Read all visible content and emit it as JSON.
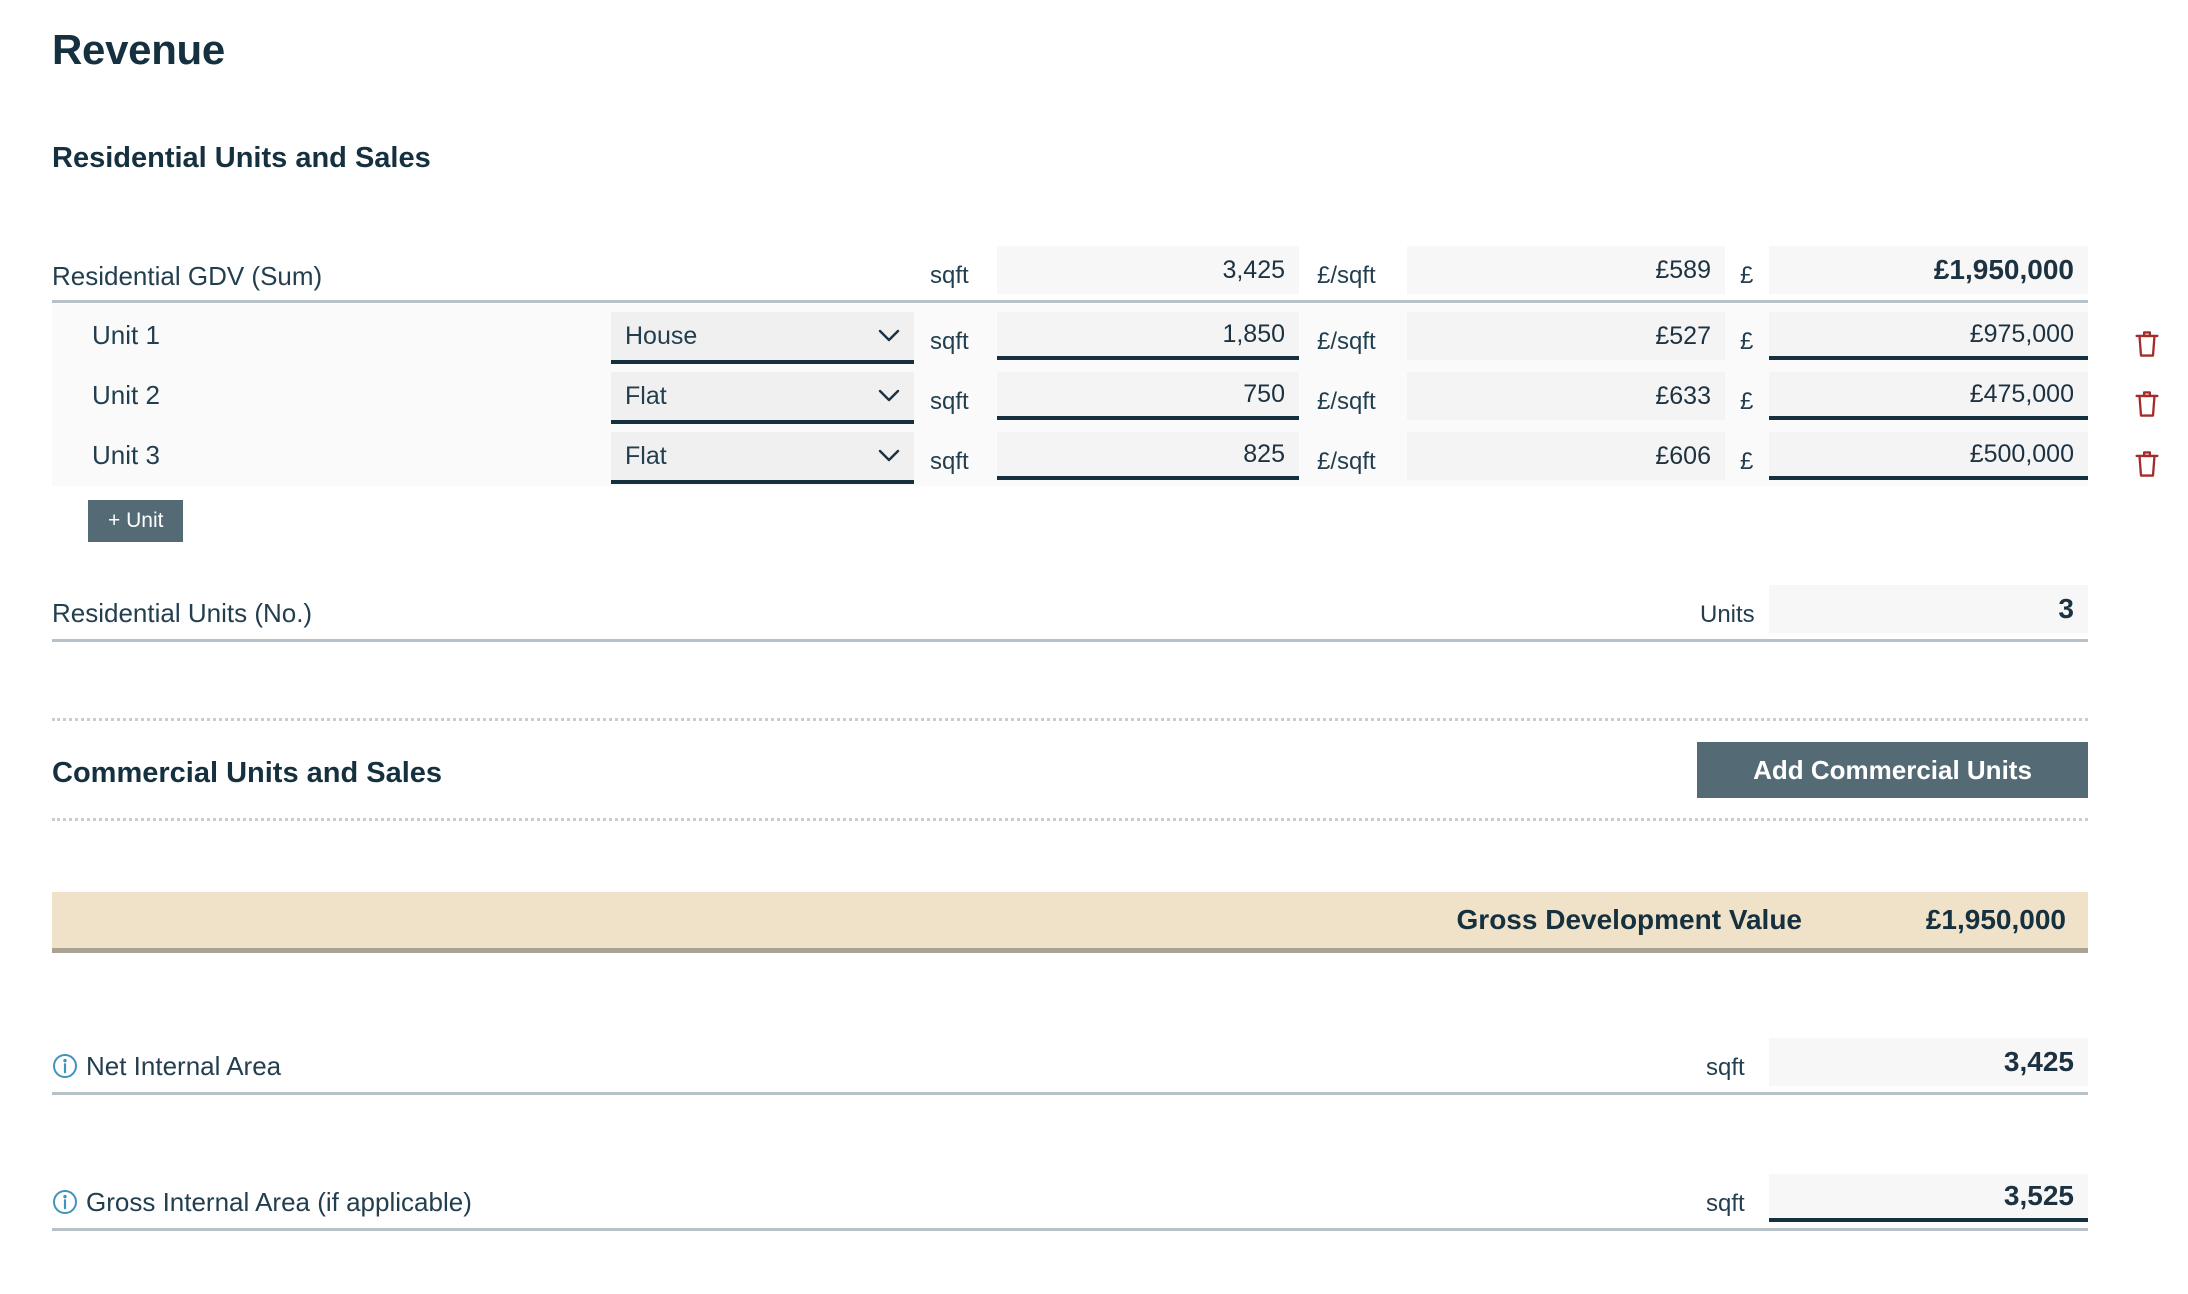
{
  "page": {
    "title": "Revenue"
  },
  "residential": {
    "section_title": "Residential Units and Sales",
    "summary": {
      "label": "Residential GDV (Sum)",
      "area_unit": "sqft",
      "area_value": "3,425",
      "rate_unit": "£/sqft",
      "rate_value": "£589",
      "currency_unit": "£",
      "total_value": "£1,950,000"
    },
    "units": [
      {
        "label": "Unit 1",
        "type": "House",
        "area_unit": "sqft",
        "area_value": "1,850",
        "rate_unit": "£/sqft",
        "rate_value": "£527",
        "currency_unit": "£",
        "total_value": "£975,000",
        "delete_icon": "trash-icon"
      },
      {
        "label": "Unit 2",
        "type": "Flat",
        "area_unit": "sqft",
        "area_value": "750",
        "rate_unit": "£/sqft",
        "rate_value": "£633",
        "currency_unit": "£",
        "total_value": "£475,000",
        "delete_icon": "trash-icon"
      },
      {
        "label": "Unit 3",
        "type": "Flat",
        "area_unit": "sqft",
        "area_value": "825",
        "rate_unit": "£/sqft",
        "rate_value": "£606",
        "currency_unit": "£",
        "total_value": "£500,000",
        "delete_icon": "trash-icon"
      }
    ],
    "unit_type_options": [
      "House",
      "Flat"
    ],
    "add_unit_label": "+ Unit",
    "units_count": {
      "label": "Residential Units (No.)",
      "unit": "Units",
      "value": "3"
    }
  },
  "commercial": {
    "section_title": "Commercial Units and Sales",
    "add_button_label": "Add Commercial Units"
  },
  "gdv": {
    "label": "Gross Development Value",
    "value": "£1,950,000"
  },
  "areas": [
    {
      "label": "Net Internal Area",
      "info_icon": "info-icon",
      "unit": "sqft",
      "value": "3,425"
    },
    {
      "label": "Gross Internal Area (if applicable)",
      "info_icon": "info-icon",
      "unit": "sqft",
      "value": "3,525"
    }
  ],
  "colors": {
    "heading": "#15303f",
    "accent_button": "#546a74",
    "banner_bg": "#f0e2c8",
    "delete_icon": "#a52a2a",
    "info_icon": "#3f93bd",
    "field_bg": "#f4f4f4",
    "underline": "#b7c2c8"
  }
}
